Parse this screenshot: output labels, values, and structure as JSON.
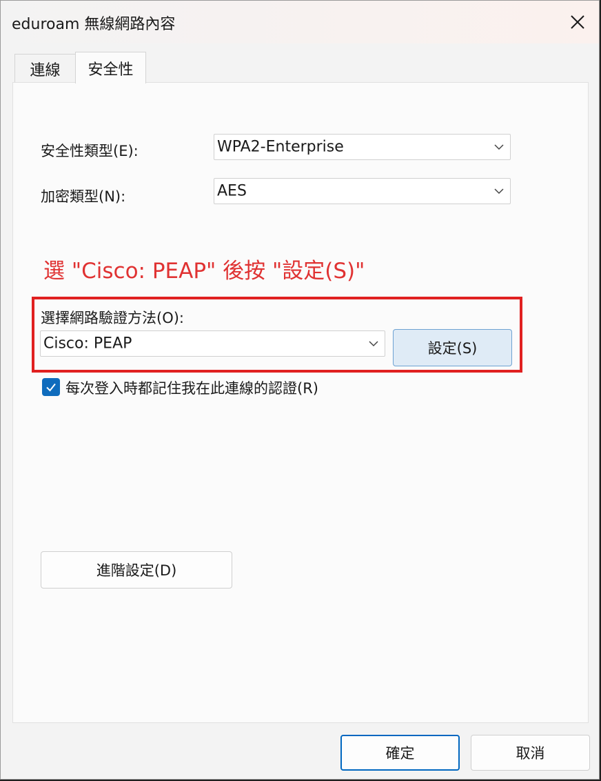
{
  "window": {
    "title": "eduroam 無線網路內容",
    "close_icon": "close-icon"
  },
  "tabs": [
    {
      "label": "連線",
      "selected": false
    },
    {
      "label": "安全性",
      "selected": true
    }
  ],
  "security": {
    "security_type_label": "安全性類型(E):",
    "security_type_value": "WPA2-Enterprise",
    "encryption_type_label": "加密類型(N):",
    "encryption_type_value": "AES"
  },
  "instruction": {
    "text": "選 \"Cisco: PEAP\" 後按 \"設定(S)\"",
    "color": "#e03232"
  },
  "auth": {
    "method_label": "選擇網路驗證方法(O):",
    "method_value": "Cisco: PEAP",
    "settings_button": "設定(S)"
  },
  "remember": {
    "label": "每次登入時都記住我在此連線的認證(R)",
    "checked": true
  },
  "advanced_button": "進階設定(D)",
  "footer": {
    "ok_button": "確定",
    "cancel_button": "取消"
  },
  "colors": {
    "accent": "#0f6cbd",
    "highlight_border": "#e02020"
  }
}
